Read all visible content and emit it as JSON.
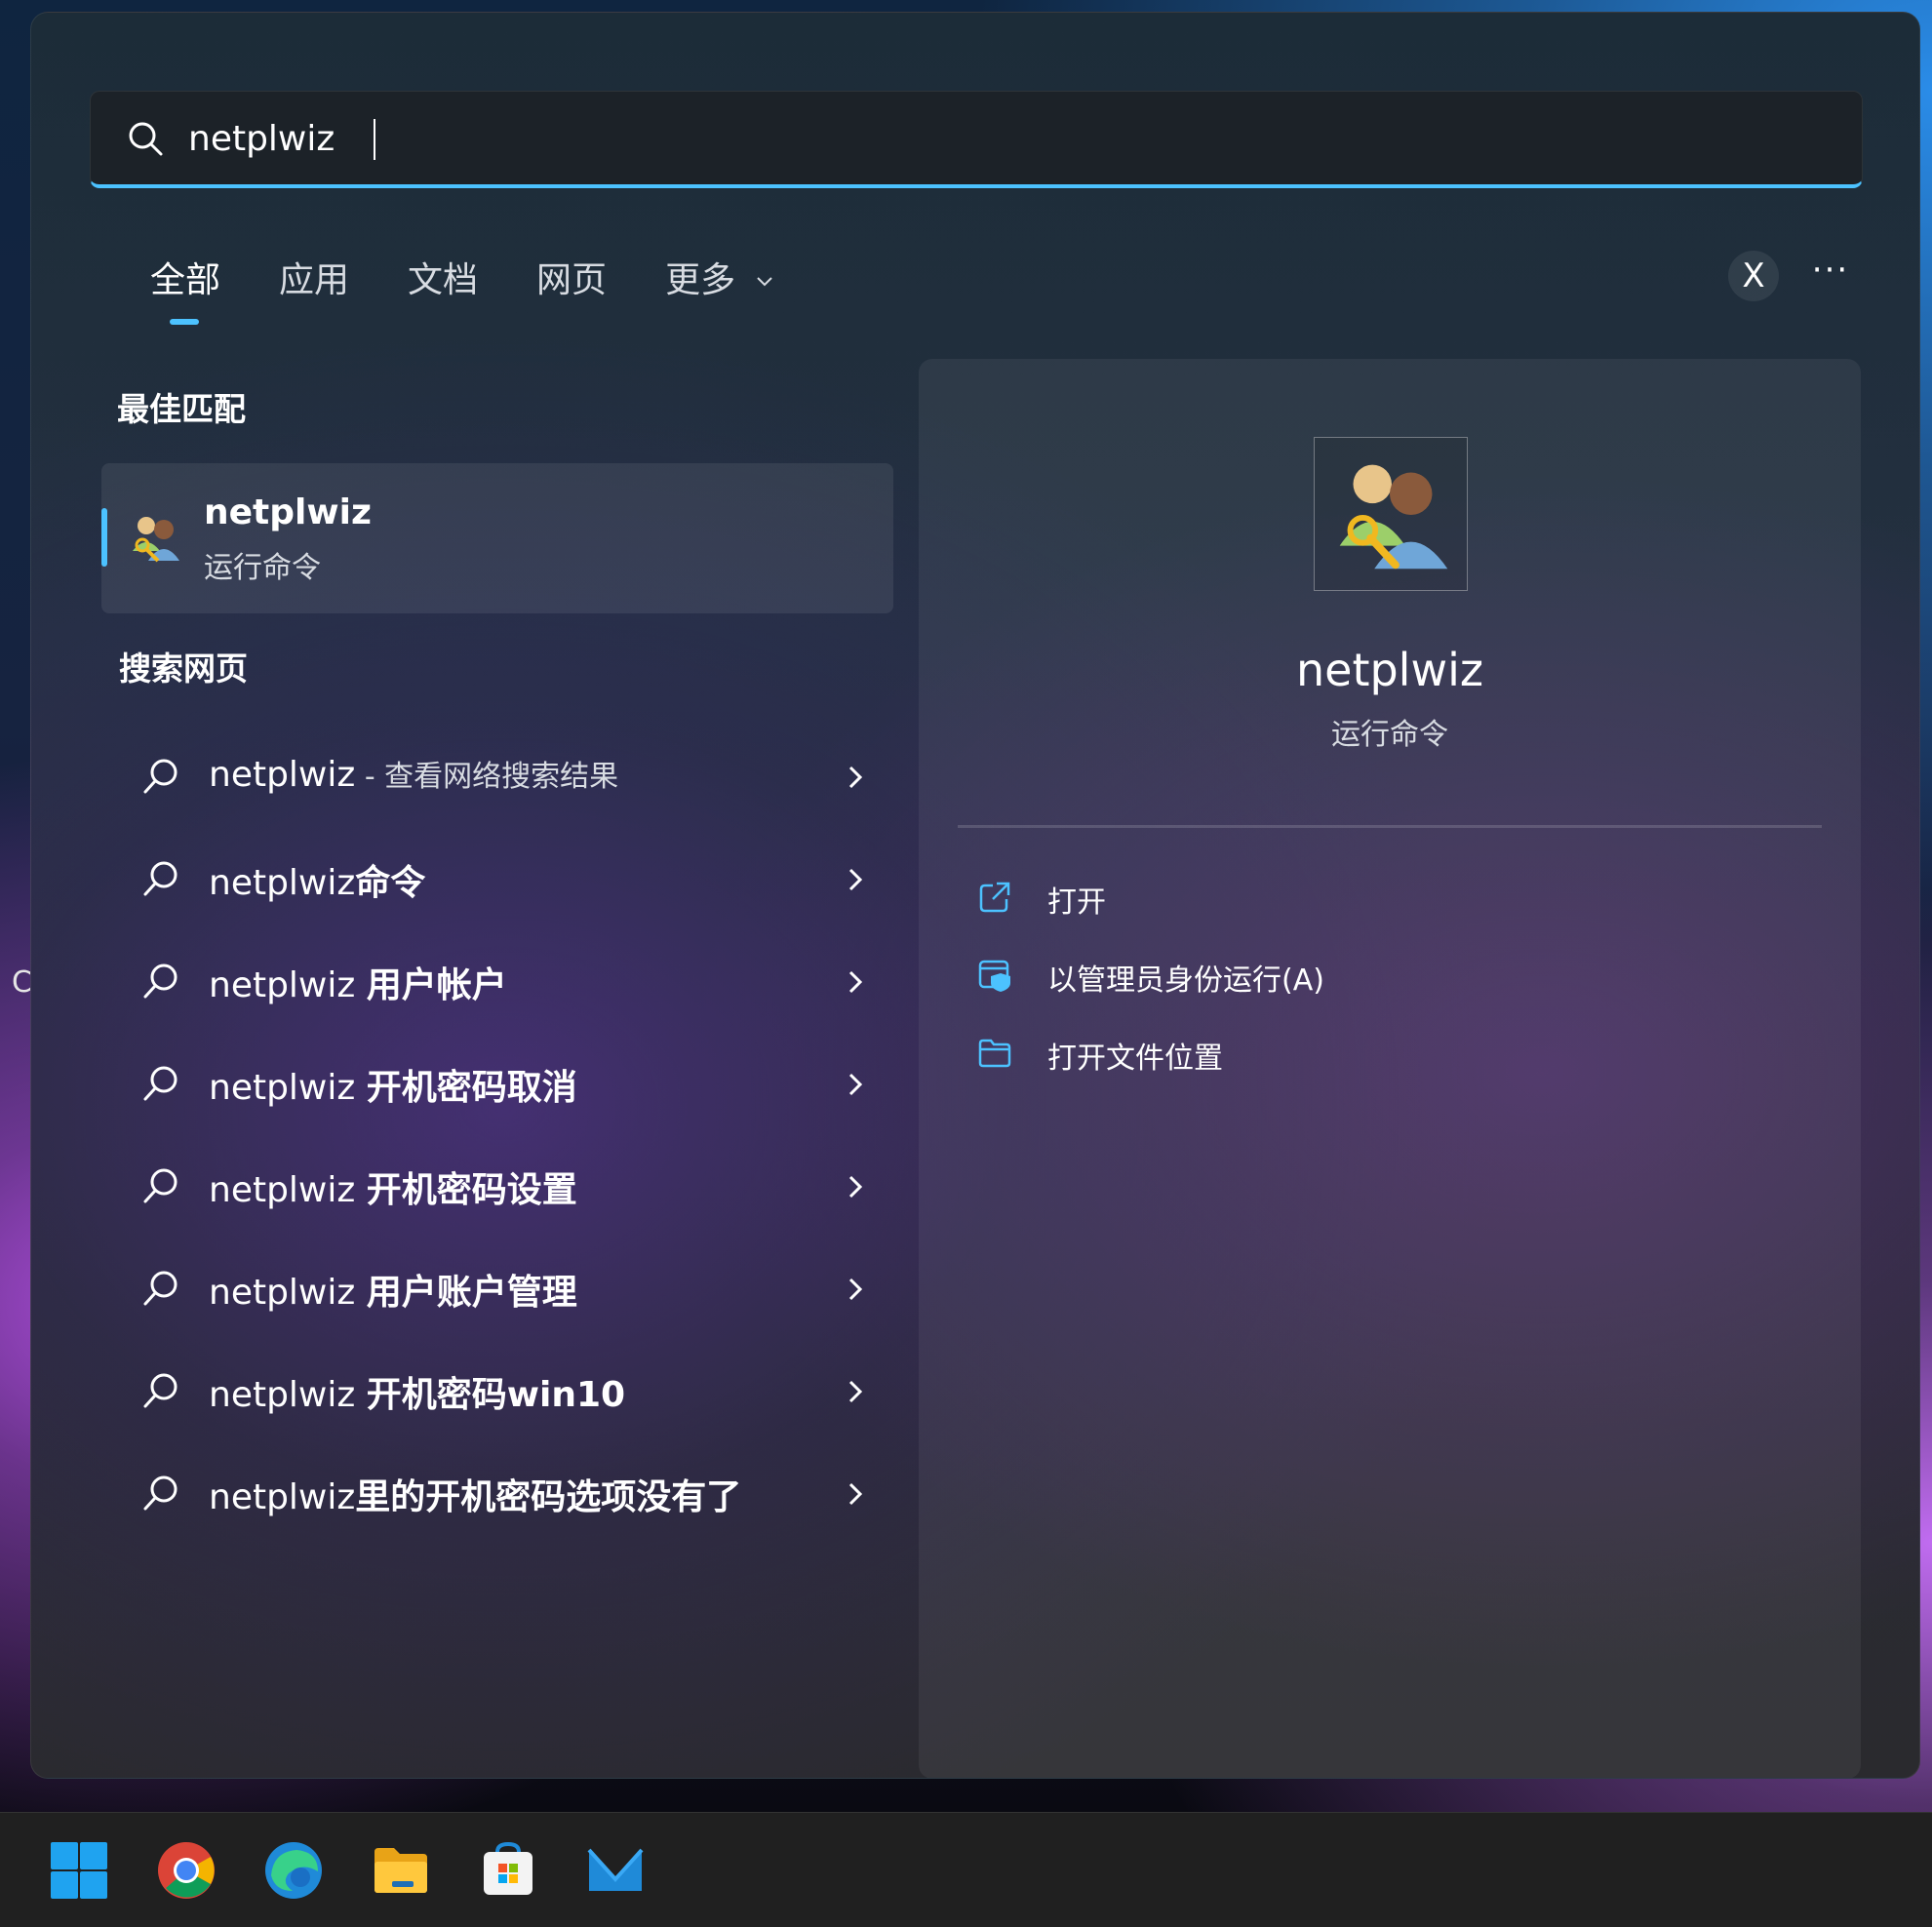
{
  "search": {
    "value": "netplwiz",
    "placeholder": ""
  },
  "tabs": [
    {
      "label": "全部",
      "active": true
    },
    {
      "label": "应用"
    },
    {
      "label": "文档"
    },
    {
      "label": "网页"
    },
    {
      "label": "更多"
    }
  ],
  "header_buttons": {
    "x_label": "X",
    "more_label": "···"
  },
  "best_match": {
    "section_title": "最佳匹配",
    "name": "netplwiz",
    "type": "运行命令"
  },
  "web_search": {
    "section_title": "搜索网页",
    "items": [
      {
        "prefix": "netplwiz",
        "hint": " - 查看网络搜索结果",
        "bold": ""
      },
      {
        "prefix": "netplwiz",
        "hint": "",
        "bold": "命令"
      },
      {
        "prefix": "netplwiz ",
        "hint": "",
        "bold": "用户帐户"
      },
      {
        "prefix": "netplwiz ",
        "hint": "",
        "bold": "开机密码取消"
      },
      {
        "prefix": "netplwiz ",
        "hint": "",
        "bold": "开机密码设置"
      },
      {
        "prefix": "netplwiz ",
        "hint": "",
        "bold": "用户账户管理"
      },
      {
        "prefix": "netplwiz ",
        "hint": "",
        "bold": "开机密码win10"
      },
      {
        "prefix": "netplwiz",
        "hint": "",
        "bold": "里的开机密码选项没有了"
      }
    ]
  },
  "detail": {
    "title": "netplwiz",
    "subtitle": "运行命令",
    "actions": [
      {
        "label": "打开",
        "icon": "open-external-icon"
      },
      {
        "label": "以管理员身份运行(A)",
        "icon": "admin-shield-icon"
      },
      {
        "label": "打开文件位置",
        "icon": "folder-icon"
      }
    ]
  },
  "desktop": {
    "peek_letter": "C"
  },
  "taskbar": {
    "icons": [
      "windows-start-icon",
      "chrome-icon",
      "edge-icon",
      "file-explorer-icon",
      "microsoft-store-icon",
      "mail-icon"
    ]
  },
  "colors": {
    "accent": "#4cc2ff",
    "panel": "#24303c",
    "taskbar": "#202020"
  }
}
